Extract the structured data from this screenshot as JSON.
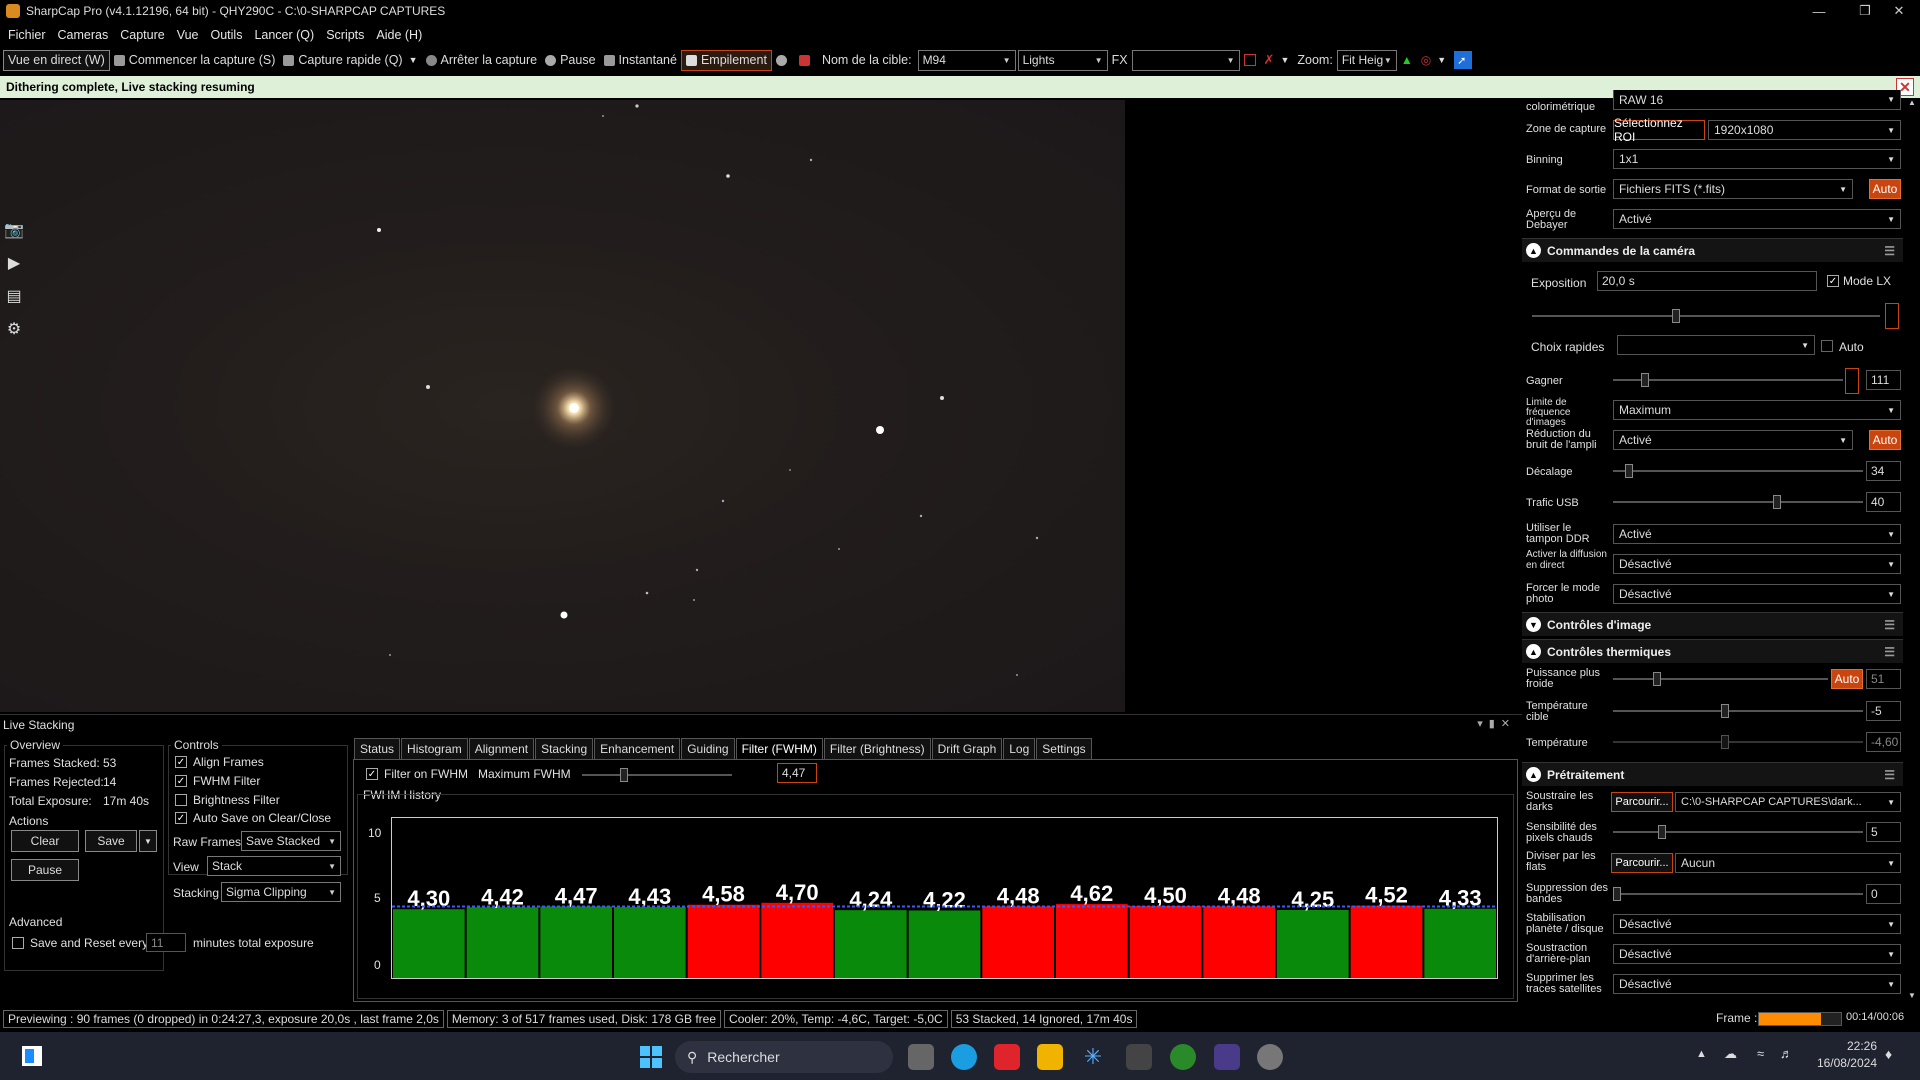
{
  "window": {
    "title": "SharpCap Pro (v4.1.12196, 64 bit) - QHY290C - C:\\0-SHARPCAP CAPTURES"
  },
  "menu": [
    "Fichier",
    "Cameras",
    "Capture",
    "Vue",
    "Outils",
    "Lancer (Q)",
    "Scripts",
    "Aide (H)"
  ],
  "toolbar": {
    "live_view": "Vue en direct (W)",
    "start_capture": "Commencer la capture (S)",
    "quick_capture": "Capture rapide (Q)",
    "stop_capture": "Arrêter la capture",
    "pause": "Pause",
    "snapshot": "Instantané",
    "stacking": "Empilement",
    "target_label": "Nom de la cible:",
    "target_value": "M94",
    "frame_type": "Lights",
    "fx_label": "FX",
    "fx_value": "",
    "zoom_label": "Zoom:",
    "zoom_value": "Fit Heig"
  },
  "notification": "Dithering complete, Live stacking resuming",
  "right_panel": {
    "color_space_label": "colorimétrique",
    "color_space_value": "RAW 16",
    "capture_area_label": "Zone de capture",
    "roi_button": "Sélectionnez ROI",
    "capture_area_value": "1920x1080",
    "binning_label": "Binning",
    "binning_value": "1x1",
    "output_format_label": "Format de sortie",
    "output_format_value": "Fichiers FITS (*.fits)",
    "auto": "Auto",
    "debayer_label": "Aperçu de Debayer",
    "debayer_value": "Activé",
    "camera_controls_title": "Commandes de la caméra",
    "exposure_label": "Exposition",
    "exposure_value": "20,0 s",
    "lx_mode_label": "Mode LX",
    "quick_choice_label": "Choix rapides",
    "gain_label": "Gagner",
    "gain_value": "111",
    "frame_rate_label": "Limite de fréquence d'images",
    "frame_rate_value": "Maximum",
    "amp_noise_label": "Réduction du bruit de l'ampli",
    "amp_noise_value": "Activé",
    "offset_label": "Décalage",
    "offset_value": "34",
    "usb_label": "Trafic USB",
    "usb_value": "40",
    "ddr_label": "Utiliser le tampon DDR",
    "ddr_value": "Activé",
    "stream_label": "Activer la diffusion en direct",
    "stream_value": "Désactivé",
    "photo_mode_label": "Forcer le mode photo",
    "photo_mode_value": "Désactivé",
    "image_controls_title": "Contrôles d'image",
    "thermal_title": "Contrôles thermiques",
    "cooler_power_label": "Puissance plus froide",
    "cooler_power_value": "51",
    "target_temp_label": "Température cible",
    "target_temp_value": "-5",
    "temp_label": "Température",
    "temp_value": "-4,60",
    "preprocess_title": "Prétraitement",
    "dark_label": "Soustraire les darks",
    "browse": "Parcourir...",
    "dark_value": "C:\\0-SHARPCAP CAPTURES\\dark...",
    "hot_pixel_label": "Sensibilité des pixels chauds",
    "hot_pixel_value": "5",
    "flats_label": "Diviser par les flats",
    "flats_value": "Aucun",
    "banding_label": "Suppression des bandes",
    "banding_value": "0",
    "stab_label": "Stabilisation planète / disque",
    "stab_value": "Désactivé",
    "bg_label": "Soustraction d'arrière-plan",
    "bg_value": "Désactivé",
    "sat_label": "Supprimer les traces satellites",
    "sat_value": "Désactivé"
  },
  "live_stacking": {
    "title": "Live Stacking",
    "overview_title": "Overview",
    "frames_stacked_label": "Frames Stacked:",
    "frames_stacked": "53",
    "frames_rejected_label": "Frames Rejected:",
    "frames_rejected": "14",
    "total_exposure_label": "Total Exposure:",
    "total_exposure": "17m 40s",
    "actions_title": "Actions",
    "clear": "Clear",
    "save": "Save",
    "pause": "Pause",
    "advanced_title": "Advanced",
    "save_reset_label": "Save and Reset every",
    "save_reset_value": "11",
    "minutes_label": "minutes total exposure",
    "controls_title": "Controls",
    "align_frames": "Align Frames",
    "fwhm_filter": "FWHM Filter",
    "brightness_filter": "Brightness Filter",
    "auto_save": "Auto Save on Clear/Close",
    "raw_frames_label": "Raw Frames",
    "raw_frames_value": "Save Stacked",
    "view_label": "View",
    "view_value": "Stack",
    "stacking_label": "Stacking",
    "stacking_value": "Sigma Clipping",
    "tabs": [
      "Status",
      "Histogram",
      "Alignment",
      "Stacking",
      "Enhancement",
      "Guiding",
      "Filter (FWHM)",
      "Filter (Brightness)",
      "Drift Graph",
      "Log",
      "Settings"
    ],
    "filter_on_fwhm": "Filter on FWHM",
    "max_fwhm_label": "Maximum FWHM",
    "max_fwhm_value": "4,47",
    "history_title": "FWHM History"
  },
  "chart_data": {
    "type": "bar",
    "title": "FWHM History",
    "ylim": [
      0,
      10
    ],
    "yticks": [
      "10",
      "5",
      "0"
    ],
    "threshold": 4.47,
    "labels": [
      "4,30",
      "4,42",
      "4,47",
      "4,43",
      "4,58",
      "4,70",
      "4,24",
      "4,22",
      "4,48",
      "4,62",
      "4,50",
      "4,48",
      "4,25",
      "4,52",
      "4,33"
    ],
    "values": [
      4.3,
      4.42,
      4.47,
      4.43,
      4.58,
      4.7,
      4.24,
      4.22,
      4.48,
      4.62,
      4.5,
      4.48,
      4.25,
      4.52,
      4.33
    ],
    "colors": {
      "accepted": "#0a8a0a",
      "rejected": "#ff0000"
    }
  },
  "status": {
    "preview": "Previewing : 90 frames (0 dropped) in 0:24:27,3, exposure 20,0s , last frame 2,0s",
    "memory": "Memory: 3 of 517 frames used, Disk: 178 GB free",
    "cooler": "Cooler: 20%, Temp: -4,6C, Target: -5,0C",
    "stacked": "53 Stacked, 14 Ignored, 17m 40s",
    "frame_label": "Frame :",
    "frame_time": "00:14/00:06"
  },
  "taskbar": {
    "search": "Rechercher",
    "time": "22:26",
    "date": "16/08/2024"
  },
  "colors": {
    "accent": "#c9450f",
    "notif_bg": "#dff0d8"
  }
}
